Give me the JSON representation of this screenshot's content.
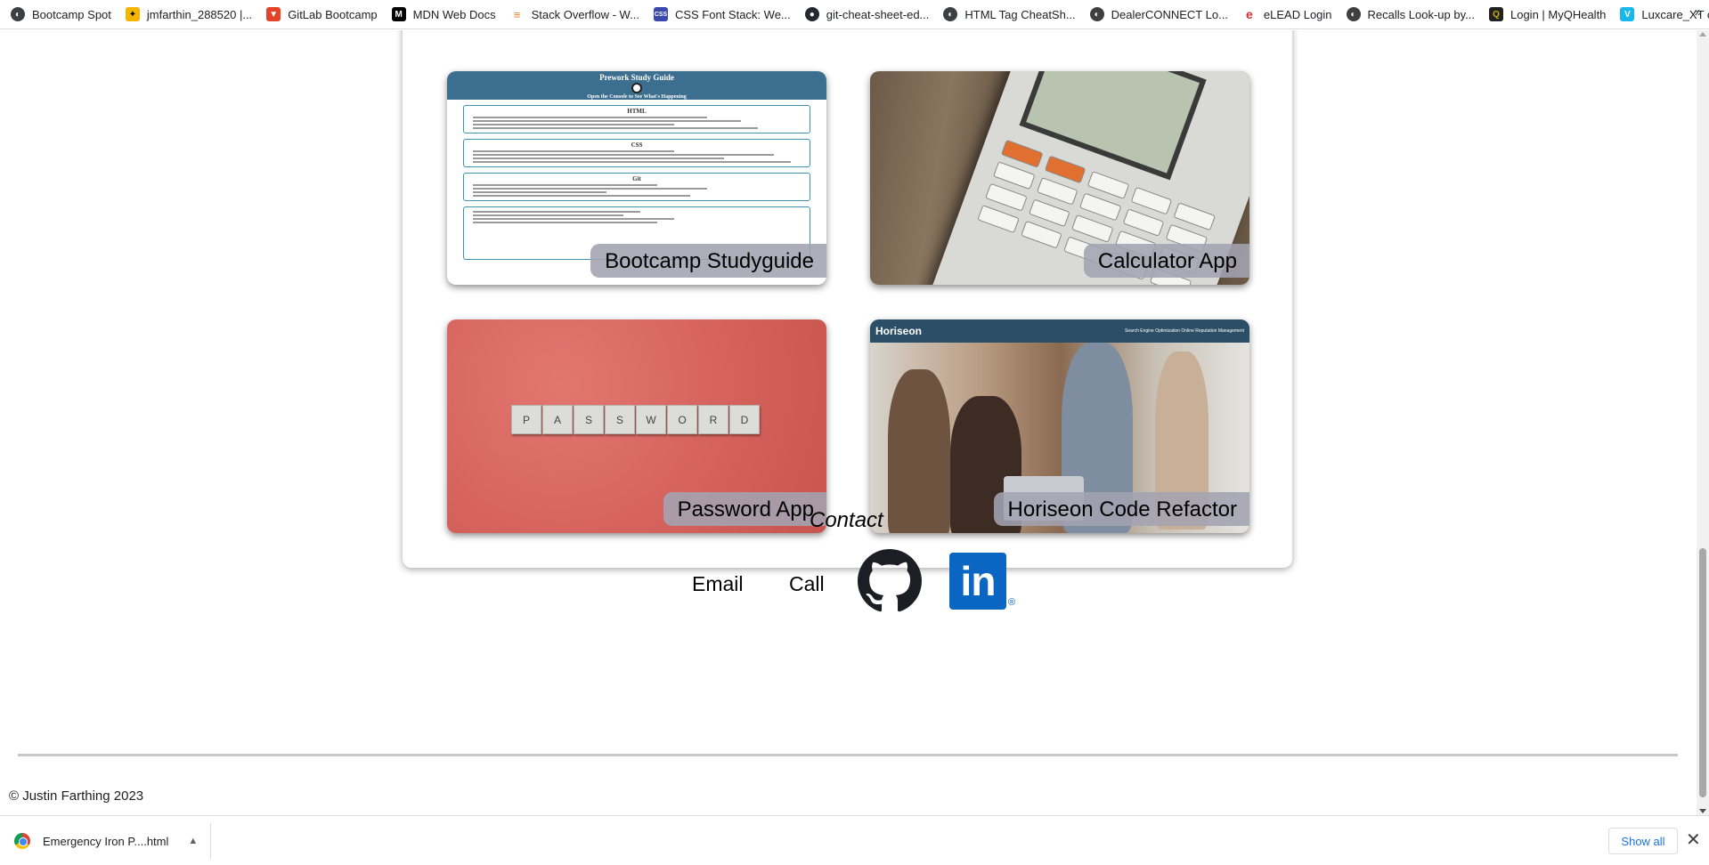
{
  "bookmarks": [
    {
      "label": "Bootcamp Spot",
      "icon": "globe-icon",
      "color": "#3c4043"
    },
    {
      "label": "jmfarthin_288520 |...",
      "icon": "bee-icon",
      "color": "#f4b400"
    },
    {
      "label": "GitLab Bootcamp",
      "icon": "gitlab-icon",
      "color": "#e24329"
    },
    {
      "label": "MDN Web Docs",
      "icon": "mdn-icon",
      "color": "#000000"
    },
    {
      "label": "Stack Overflow - W...",
      "icon": "stackoverflow-icon",
      "color": "#f48024"
    },
    {
      "label": "CSS Font Stack: We...",
      "icon": "cssfontstack-icon",
      "color": "#3949ab"
    },
    {
      "label": "git-cheat-sheet-ed...",
      "icon": "github-icon",
      "color": "#24292e"
    },
    {
      "label": "HTML Tag CheatSh...",
      "icon": "globe-icon",
      "color": "#3c4043"
    },
    {
      "label": "DealerCONNECT Lo...",
      "icon": "globe-icon",
      "color": "#3c4043"
    },
    {
      "label": "eLEAD Login",
      "icon": "elead-icon",
      "color": "#d32f2f"
    },
    {
      "label": "Recalls Look-up by...",
      "icon": "globe-icon",
      "color": "#3c4043"
    },
    {
      "label": "Login | MyQHealth",
      "icon": "myqhealth-icon",
      "color": "#c8b400"
    },
    {
      "label": "Luxcare_XT on Vimeo",
      "icon": "vimeo-icon",
      "color": "#1ab7ea"
    }
  ],
  "bookmarks_more": "»",
  "projects": [
    {
      "label": "Bootcamp Studyguide"
    },
    {
      "label": "Calculator App"
    },
    {
      "label": "Password App"
    },
    {
      "label": "Horiseon Code Refactor"
    }
  ],
  "studyguide_thumb": {
    "title": "Prework Study Guide",
    "subtitle": "Open the Console to See What's Happening",
    "sections": [
      "HTML",
      "CSS",
      "Git"
    ]
  },
  "password_thumb": {
    "letters": [
      "P",
      "A",
      "S",
      "S",
      "W",
      "O",
      "R",
      "D"
    ]
  },
  "horiseon_thumb": {
    "brand": "Horiseon",
    "nav": "Search Engine Optimization     Online Reputation Management"
  },
  "contact": {
    "heading": "Contact",
    "email_label": "Email",
    "call_label": "Call",
    "linkedin_text": "in",
    "linkedin_reg": "®"
  },
  "footer": {
    "copyright": "© Justin Farthing 2023"
  },
  "download_bar": {
    "file_name": "Emergency Iron P....html",
    "show_all": "Show all",
    "close": "✕"
  },
  "colors": {
    "accent": "#0a66c2",
    "header_blue": "#3c6e8f",
    "label_bg": "#a3a3b2"
  }
}
